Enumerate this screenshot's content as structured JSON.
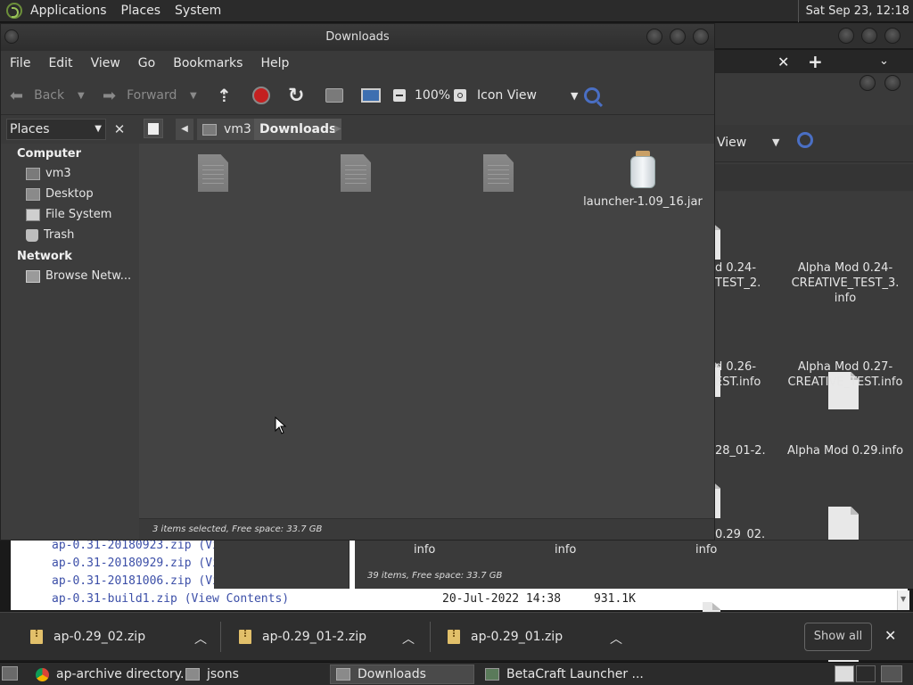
{
  "top_panel": {
    "menus": [
      "Applications",
      "Places",
      "System"
    ],
    "clock": "Sat Sep 23, 12:18"
  },
  "background_browser": {
    "rows": [
      {
        "name": "ap-0.31-20180923.zip",
        "link": "(Vi"
      },
      {
        "name": "ap-0.31-20180929.zip",
        "link": "(Vi"
      },
      {
        "name": "ap-0.31-20181006.zip",
        "link": "(Vi"
      },
      {
        "name": "ap-0.31-build1.zip",
        "link": "(View Contents)",
        "date": "20-Jul-2022 14:38",
        "size": "931.1K"
      }
    ]
  },
  "background_file_window": {
    "view_label": "View",
    "status": "39 items, Free space: 33.7 GB",
    "partial_labels": [
      {
        "l1": "d 0.24-",
        "l2": "TEST_2."
      },
      {
        "l1": "d 0.26-",
        "l2": "EST.info"
      },
      {
        "l1": "28_01-2.",
        "l2": ""
      },
      {
        "l1": "0.29_02.",
        "l2": "info"
      }
    ],
    "bottom_labels": [
      "info",
      "info"
    ],
    "files": [
      {
        "label": "Alpha Mod 0.24-CREATIVE_TEST_3.info",
        "lines": [
          "Alpha Mod 0.24-",
          "CREATIVE_TEST_3.",
          "info"
        ]
      },
      {
        "label": "Alpha Mod 0.27-CREATIVE_TEST.info",
        "lines": [
          "Alpha Mod 0.27-",
          "CREATIVE_TEST.info"
        ]
      },
      {
        "label": "Alpha Mod 0.29.info",
        "lines": [
          "Alpha Mod 0.29.info"
        ]
      }
    ]
  },
  "window": {
    "title": "Downloads",
    "menus": [
      "File",
      "Edit",
      "View",
      "Go",
      "Bookmarks",
      "Help"
    ],
    "toolbar": {
      "back": "Back",
      "forward": "Forward",
      "zoom": "100%",
      "view_mode": "Icon View"
    },
    "side_combo": "Places",
    "breadcrumb": [
      "vm3",
      "Downloads"
    ],
    "sidebar": {
      "sections": [
        {
          "title": "Computer",
          "items": [
            "vm3",
            "Desktop",
            "File System",
            "Trash"
          ]
        },
        {
          "title": "Network",
          "items": [
            "Browse Netw..."
          ]
        }
      ]
    },
    "files": [
      {
        "label": "",
        "selected": true
      },
      {
        "label": "",
        "selected": true
      },
      {
        "label": "",
        "selected": true
      },
      {
        "label": "launcher-1.09_16.jar",
        "selected": false
      }
    ],
    "status": "3 items selected, Free space: 33.7 GB"
  },
  "downloads_shelf": {
    "items": [
      "ap-0.29_02.zip",
      "ap-0.29_01-2.zip",
      "ap-0.29_01.zip"
    ],
    "show_all": "Show all"
  },
  "taskbar": {
    "tasks": [
      "ap-archive directory...",
      "jsons",
      "Downloads",
      "BetaCraft Launcher ..."
    ],
    "active": "Downloads"
  }
}
